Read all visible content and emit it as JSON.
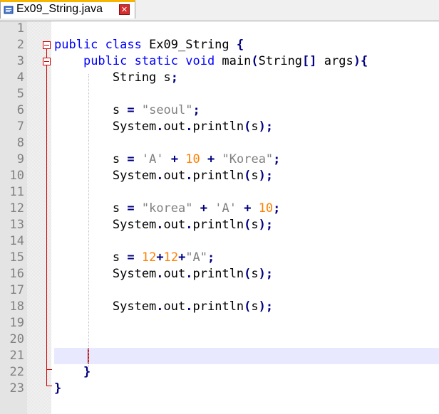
{
  "tab": {
    "label": "Ex09_String.java",
    "icon": "file-icon",
    "close_icon": "close-icon"
  },
  "line_numbers": [
    "1",
    "2",
    "3",
    "4",
    "5",
    "6",
    "7",
    "8",
    "9",
    "10",
    "11",
    "12",
    "13",
    "14",
    "15",
    "16",
    "17",
    "18",
    "19",
    "20",
    "21",
    "22",
    "23"
  ],
  "code": [
    {
      "segments": []
    },
    {
      "segments": [
        [
          "kw",
          "public class "
        ],
        [
          "plain",
          "Ex09_String "
        ],
        [
          "op",
          "{"
        ]
      ]
    },
    {
      "segments": [
        [
          "plain",
          "    "
        ],
        [
          "kw",
          "public static void "
        ],
        [
          "plain",
          "main"
        ],
        [
          "op",
          "("
        ],
        [
          "plain",
          "String"
        ],
        [
          "op",
          "[] "
        ],
        [
          "plain",
          "args"
        ],
        [
          "op",
          "){"
        ]
      ]
    },
    {
      "segments": [
        [
          "plain",
          "        String s"
        ],
        [
          "op",
          ";"
        ]
      ]
    },
    {
      "segments": []
    },
    {
      "segments": [
        [
          "plain",
          "        s "
        ],
        [
          "op",
          "= "
        ],
        [
          "str",
          "\"seoul\""
        ],
        [
          "op",
          ";"
        ]
      ]
    },
    {
      "segments": [
        [
          "plain",
          "        System"
        ],
        [
          "op",
          "."
        ],
        [
          "plain",
          "out"
        ],
        [
          "op",
          "."
        ],
        [
          "plain",
          "println"
        ],
        [
          "op",
          "("
        ],
        [
          "plain",
          "s"
        ],
        [
          "op",
          ");"
        ]
      ]
    },
    {
      "segments": []
    },
    {
      "segments": [
        [
          "plain",
          "        s "
        ],
        [
          "op",
          "= "
        ],
        [
          "str",
          "'A'"
        ],
        [
          "plain",
          " "
        ],
        [
          "op",
          "+ "
        ],
        [
          "num",
          "10"
        ],
        [
          "plain",
          " "
        ],
        [
          "op",
          "+ "
        ],
        [
          "str",
          "\"Korea\""
        ],
        [
          "op",
          ";"
        ]
      ]
    },
    {
      "segments": [
        [
          "plain",
          "        System"
        ],
        [
          "op",
          "."
        ],
        [
          "plain",
          "out"
        ],
        [
          "op",
          "."
        ],
        [
          "plain",
          "println"
        ],
        [
          "op",
          "("
        ],
        [
          "plain",
          "s"
        ],
        [
          "op",
          ");"
        ]
      ]
    },
    {
      "segments": []
    },
    {
      "segments": [
        [
          "plain",
          "        s "
        ],
        [
          "op",
          "= "
        ],
        [
          "str",
          "\"korea\""
        ],
        [
          "plain",
          " "
        ],
        [
          "op",
          "+ "
        ],
        [
          "str",
          "'A'"
        ],
        [
          "plain",
          " "
        ],
        [
          "op",
          "+ "
        ],
        [
          "num",
          "10"
        ],
        [
          "op",
          ";"
        ]
      ]
    },
    {
      "segments": [
        [
          "plain",
          "        System"
        ],
        [
          "op",
          "."
        ],
        [
          "plain",
          "out"
        ],
        [
          "op",
          "."
        ],
        [
          "plain",
          "println"
        ],
        [
          "op",
          "("
        ],
        [
          "plain",
          "s"
        ],
        [
          "op",
          ");"
        ]
      ]
    },
    {
      "segments": []
    },
    {
      "segments": [
        [
          "plain",
          "        s "
        ],
        [
          "op",
          "= "
        ],
        [
          "num",
          "12"
        ],
        [
          "op",
          "+"
        ],
        [
          "num",
          "12"
        ],
        [
          "op",
          "+"
        ],
        [
          "str",
          "\"A\""
        ],
        [
          "op",
          ";"
        ]
      ]
    },
    {
      "segments": [
        [
          "plain",
          "        System"
        ],
        [
          "op",
          "."
        ],
        [
          "plain",
          "out"
        ],
        [
          "op",
          "."
        ],
        [
          "plain",
          "println"
        ],
        [
          "op",
          "("
        ],
        [
          "plain",
          "s"
        ],
        [
          "op",
          ");"
        ]
      ]
    },
    {
      "segments": []
    },
    {
      "segments": [
        [
          "plain",
          "        System"
        ],
        [
          "op",
          "."
        ],
        [
          "plain",
          "out"
        ],
        [
          "op",
          "."
        ],
        [
          "plain",
          "println"
        ],
        [
          "op",
          "("
        ],
        [
          "plain",
          "s"
        ],
        [
          "op",
          ");"
        ]
      ]
    },
    {
      "segments": []
    },
    {
      "segments": []
    },
    {
      "segments": []
    },
    {
      "segments": [
        [
          "plain",
          "    "
        ],
        [
          "op",
          "}"
        ]
      ]
    },
    {
      "segments": [
        [
          "op",
          "}"
        ]
      ]
    }
  ],
  "colors": {
    "keyword": "#0000ff",
    "string": "#808080",
    "number": "#ff8000",
    "operator": "#000080",
    "fold_marker": "#d00000",
    "caret_line": "#e8e8ff"
  }
}
